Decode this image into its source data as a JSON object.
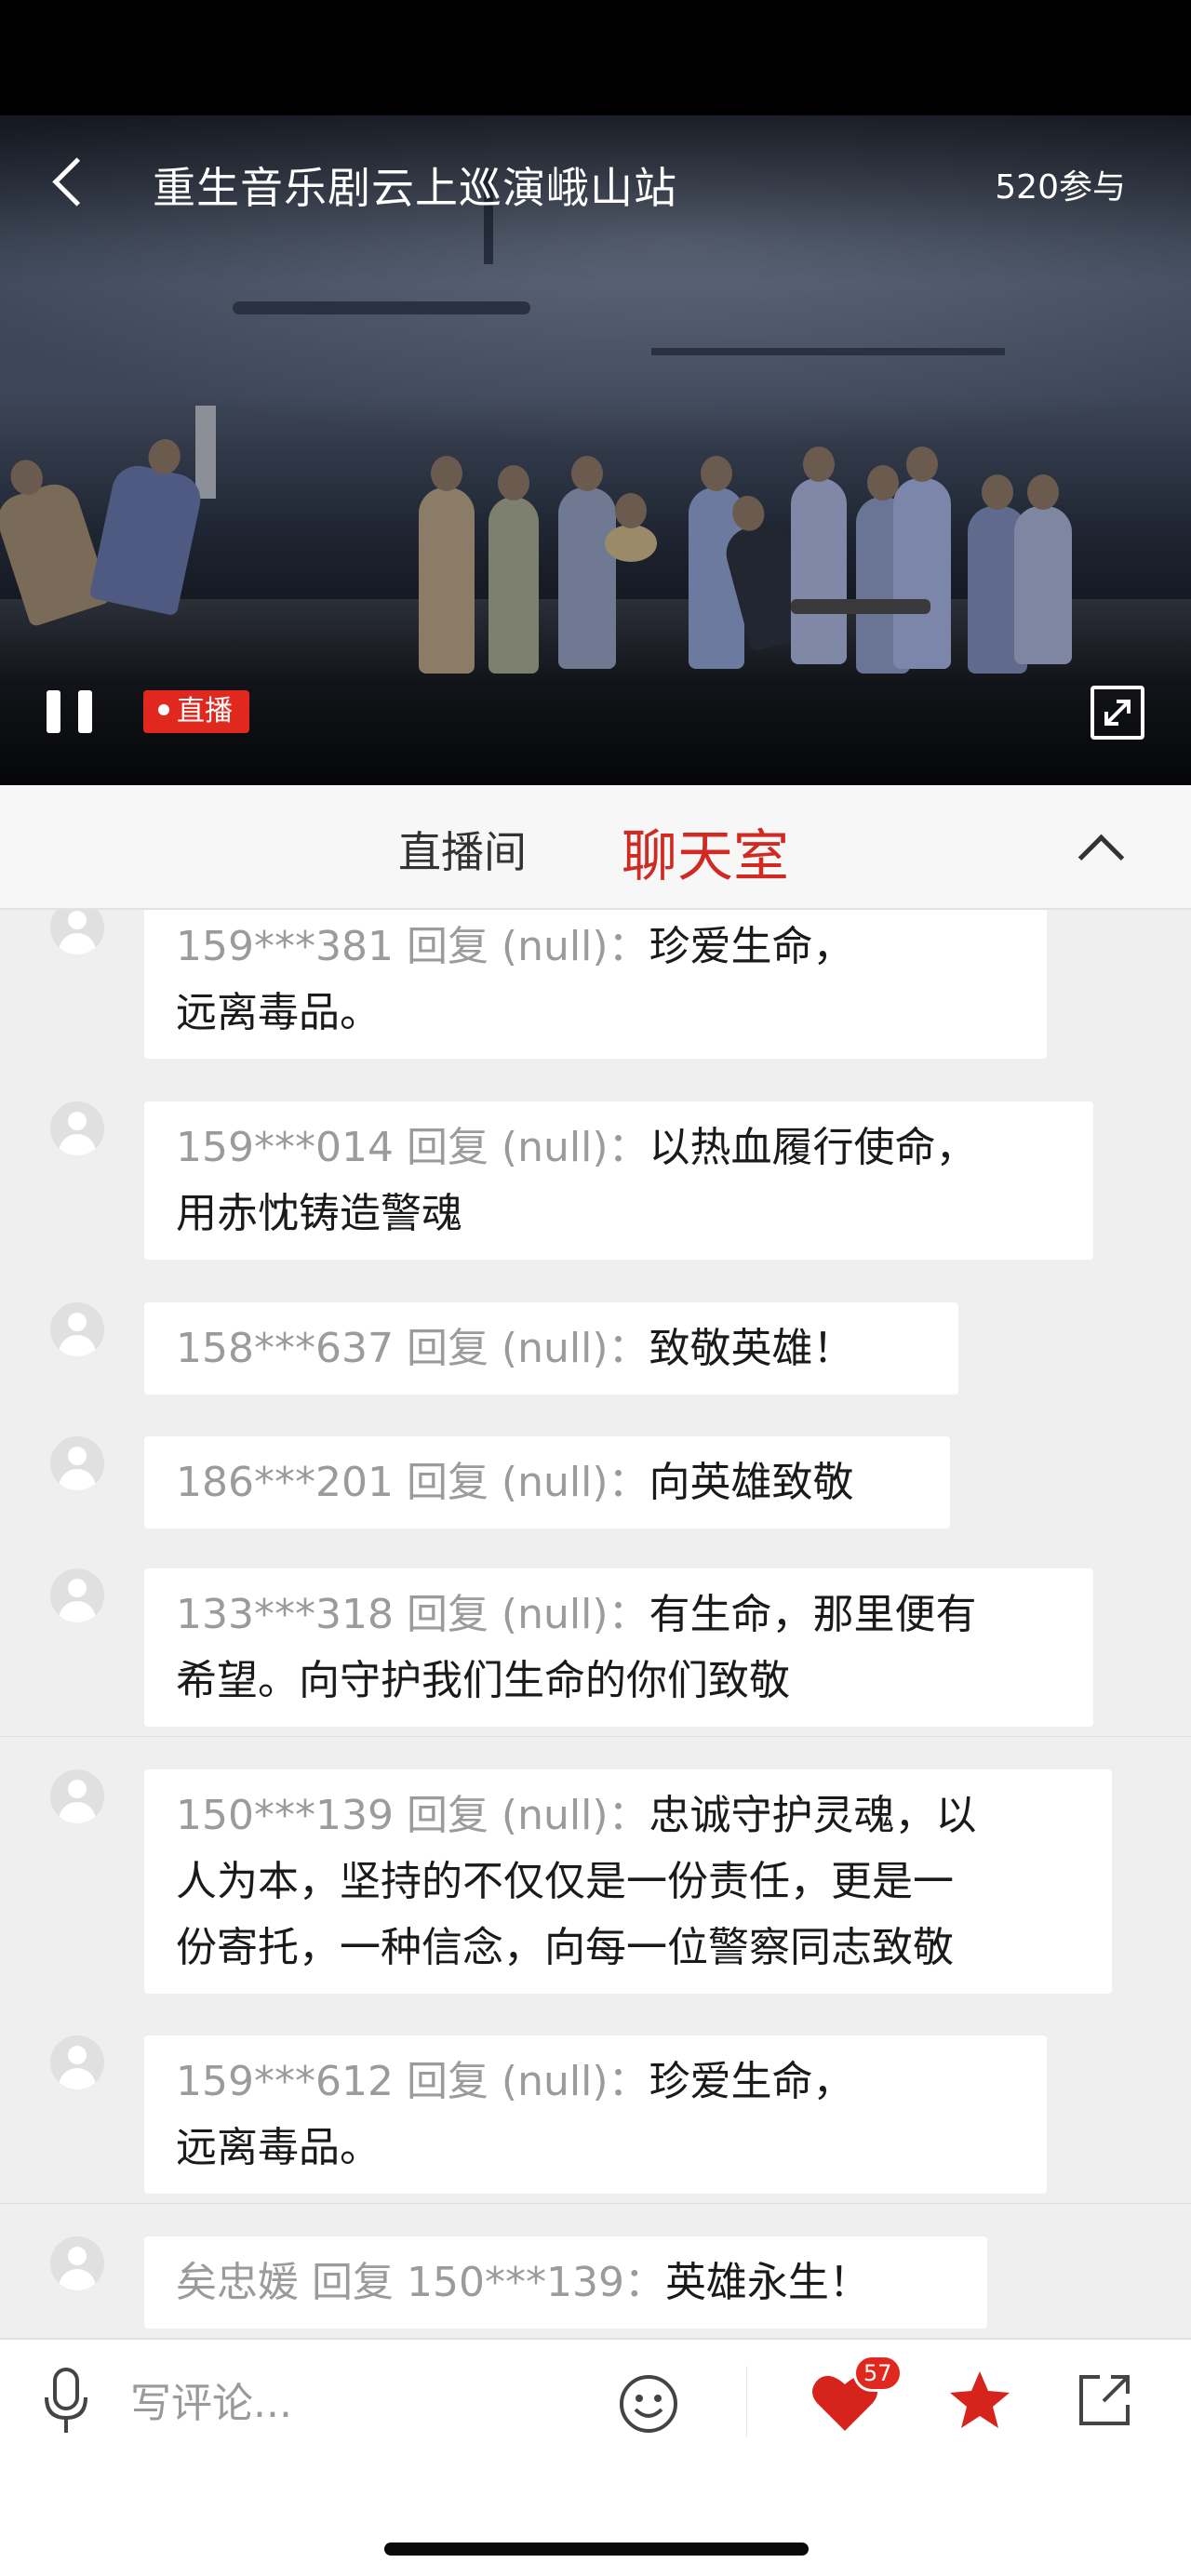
{
  "video": {
    "title": "重生音乐剧云上巡演峨山站",
    "participants": "520参与",
    "live_label": "直播"
  },
  "tabs": {
    "live_room": "直播间",
    "chat_room": "聊天室"
  },
  "messages": [
    {
      "user": "159***381 回复 (null)：",
      "text": "珍爱生命，",
      "text2": "远离毒品。"
    },
    {
      "user": "159***014 回复 (null)：",
      "text": "以热血履行使命，",
      "text2": "用赤忱铸造警魂"
    },
    {
      "user": "158***637 回复 (null)：",
      "text": "致敬英雄！",
      "text2": ""
    },
    {
      "user": "186***201 回复 (null)：",
      "text": "向英雄致敬",
      "text2": ""
    },
    {
      "user": "133***318 回复 (null)：",
      "text": "有生命，那里便有",
      "text2": "希望。向守护我们生命的你们致敬"
    },
    {
      "user": "150***139 回复 (null)：",
      "text": "忠诚守护灵魂，以",
      "text2": "人为本，坚持的不仅仅是一份责任，更是一",
      "text3": "份寄托，一种信念，向每一位警察同志致敬"
    },
    {
      "user": "159***612 回复 (null)：",
      "text": "珍爱生命，",
      "text2": "远离毒品。"
    },
    {
      "user": "矣忠媛 回复 150***139：",
      "text": "英雄永生！",
      "text2": ""
    }
  ],
  "bottom_bar": {
    "comment_placeholder": "写评论...",
    "like_count": "57"
  },
  "colors": {
    "accent_red": "#d12a23",
    "live_badge": "#e0281f",
    "username_gray": "#9b9b9b"
  },
  "icons": [
    "back-arrow-icon",
    "pause-icon",
    "fullscreen-icon",
    "chevron-up-icon",
    "user-avatar-icon",
    "microphone-icon",
    "emoji-icon",
    "heart-icon",
    "star-icon",
    "share-icon"
  ]
}
